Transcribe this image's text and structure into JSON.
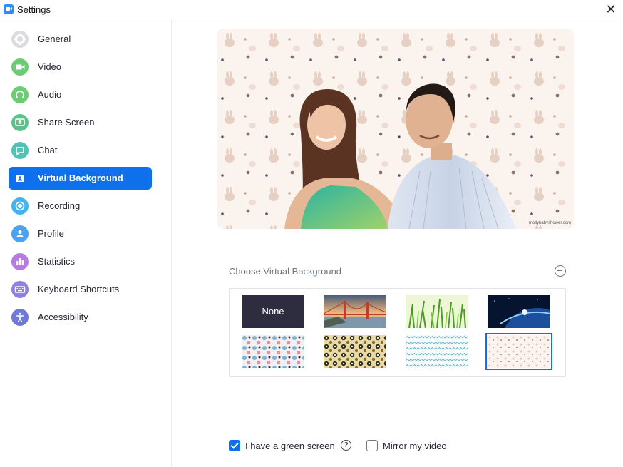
{
  "window": {
    "title": "Settings"
  },
  "sidebar": {
    "items": [
      {
        "label": "General",
        "icon": "gear-icon",
        "color": "#d9d9de"
      },
      {
        "label": "Video",
        "icon": "video-camera-icon",
        "color": "#6ccc73"
      },
      {
        "label": "Audio",
        "icon": "headphones-icon",
        "color": "#6ccc73"
      },
      {
        "label": "Share Screen",
        "icon": "share-screen-icon",
        "color": "#5cc18b"
      },
      {
        "label": "Chat",
        "icon": "chat-bubble-icon",
        "color": "#4fc4b4"
      },
      {
        "label": "Virtual Background",
        "icon": "contact-card-icon",
        "color": "#0e71eb",
        "active": true
      },
      {
        "label": "Recording",
        "icon": "record-icon",
        "color": "#3fb4ef"
      },
      {
        "label": "Profile",
        "icon": "person-icon",
        "color": "#4ba3f0"
      },
      {
        "label": "Statistics",
        "icon": "bar-chart-icon",
        "color": "#b57be0"
      },
      {
        "label": "Keyboard Shortcuts",
        "icon": "keyboard-icon",
        "color": "#8f7fde"
      },
      {
        "label": "Accessibility",
        "icon": "accessibility-icon",
        "color": "#6f79d8"
      }
    ]
  },
  "preview": {
    "watermark": "mollybabyshower.com"
  },
  "backgrounds": {
    "label": "Choose Virtual Background",
    "none_label": "None",
    "items": [
      "None",
      "Golden Gate Bridge",
      "Grass",
      "Earth from space",
      "Pattern 1",
      "Pattern 2",
      "Pattern 3",
      "Pattern 4"
    ],
    "selected_index": 7
  },
  "options": {
    "green_screen": {
      "label": "I have a green screen",
      "checked": true,
      "help_icon": "?"
    },
    "mirror": {
      "label": "Mirror my video",
      "checked": false
    }
  },
  "colors": {
    "accent": "#0e71eb"
  }
}
